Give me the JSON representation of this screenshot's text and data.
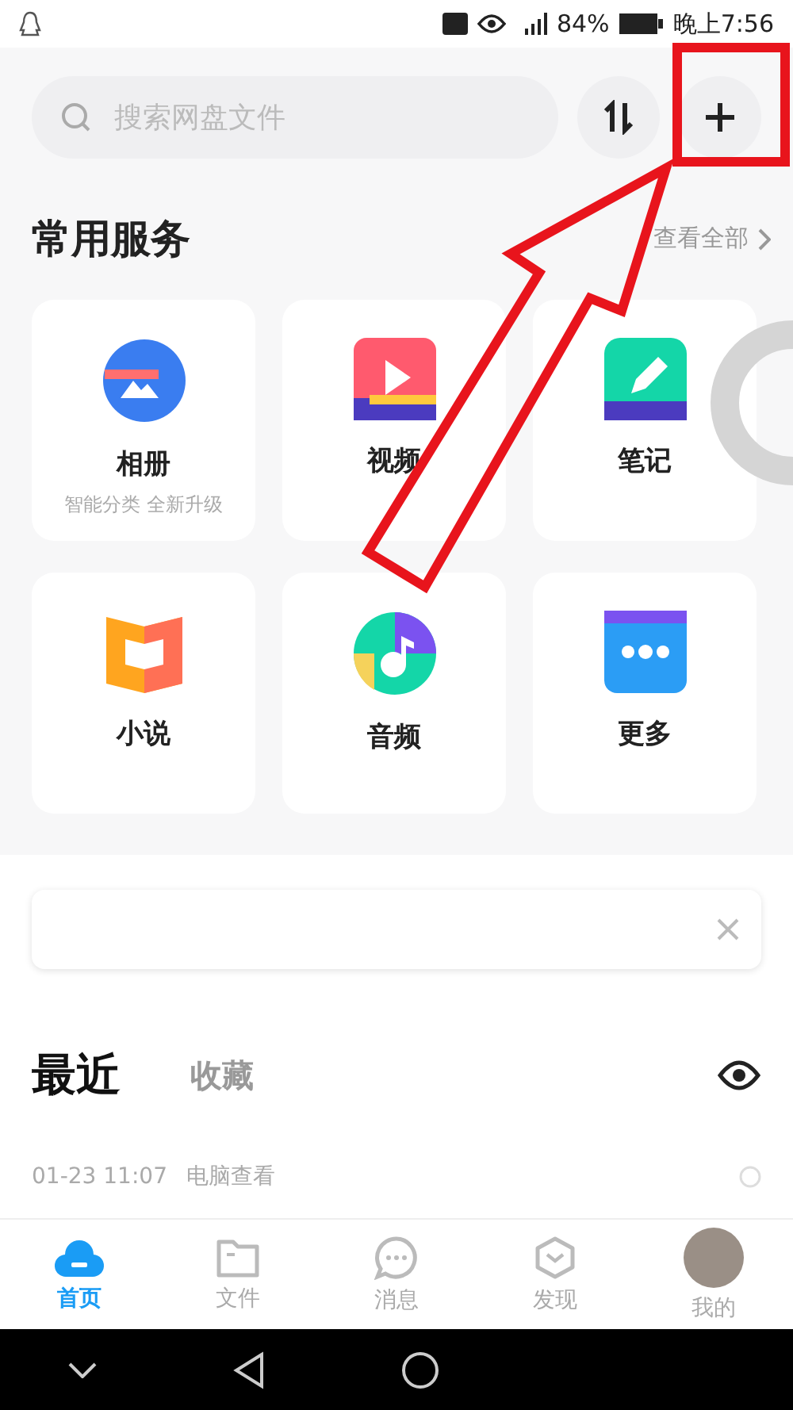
{
  "status_bar": {
    "battery": "84%",
    "time": "晚上7:56"
  },
  "search": {
    "placeholder": "搜索网盘文件"
  },
  "services": {
    "title": "常用服务",
    "view_all": "查看全部",
    "items": [
      {
        "kind": "album",
        "label": "相册",
        "subtitle": "智能分类 全新升级"
      },
      {
        "kind": "video",
        "label": "视频"
      },
      {
        "kind": "note",
        "label": "笔记"
      },
      {
        "kind": "novel",
        "label": "小说"
      },
      {
        "kind": "audio",
        "label": "音频"
      },
      {
        "kind": "more",
        "label": "更多"
      }
    ]
  },
  "feed_tabs": [
    {
      "label": "最近",
      "selected": true
    },
    {
      "label": "收藏",
      "selected": false
    }
  ],
  "recent_items": [
    {
      "time": "01-23 11:07",
      "source": "电脑查看"
    }
  ],
  "bottom_nav": [
    {
      "label": "首页",
      "kind": "home",
      "selected": true
    },
    {
      "label": "文件",
      "kind": "files",
      "selected": false
    },
    {
      "label": "消息",
      "kind": "messages",
      "selected": false
    },
    {
      "label": "发现",
      "kind": "discover",
      "selected": false
    },
    {
      "label": "我的",
      "kind": "me",
      "selected": false
    }
  ]
}
